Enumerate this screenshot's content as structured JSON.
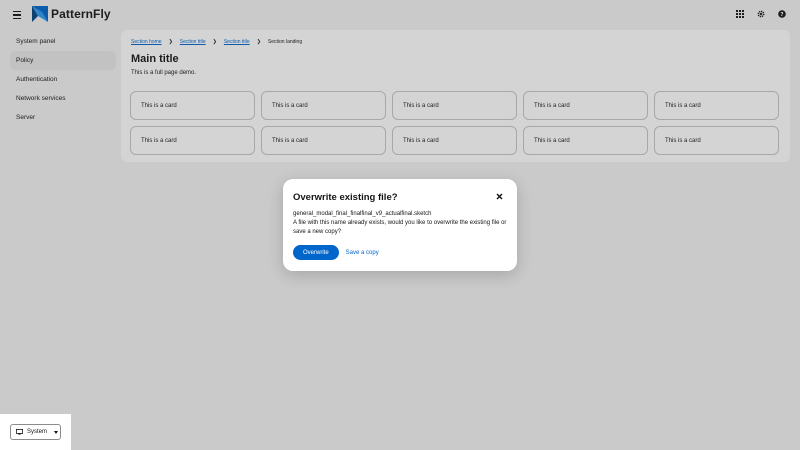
{
  "header": {
    "brand": "PatternFly",
    "colors": {
      "brand_blue": "#0066cc",
      "brand_dark": "#2b9af3"
    },
    "tools": [
      "grid-icon",
      "gear-icon",
      "help-icon"
    ]
  },
  "sidebar": {
    "items": [
      {
        "label": "System panel",
        "active": false
      },
      {
        "label": "Policy",
        "active": true
      },
      {
        "label": "Authentication",
        "active": false
      },
      {
        "label": "Network services",
        "active": false
      },
      {
        "label": "Server",
        "active": false
      }
    ]
  },
  "breadcrumb": {
    "items": [
      "Section home",
      "Section title",
      "Section title",
      "Section landing"
    ]
  },
  "main": {
    "title": "Main title",
    "description": "This is a full page demo.",
    "cards": [
      "This is a card",
      "This is a card",
      "This is a card",
      "This is a card",
      "This is a card",
      "This is a card",
      "This is a card",
      "This is a card",
      "This is a card",
      "This is a card"
    ]
  },
  "footer": {
    "system_label": "System"
  },
  "modal": {
    "title": "Overwrite existing file?",
    "filename": "general_modal_final_finalfinal_v9_actualfinal.sketch",
    "message": "A file with this name already exists, would you like to overwrite the existing file or save a new copy?",
    "primary_label": "Overwrite",
    "secondary_label": "Save a copy"
  }
}
